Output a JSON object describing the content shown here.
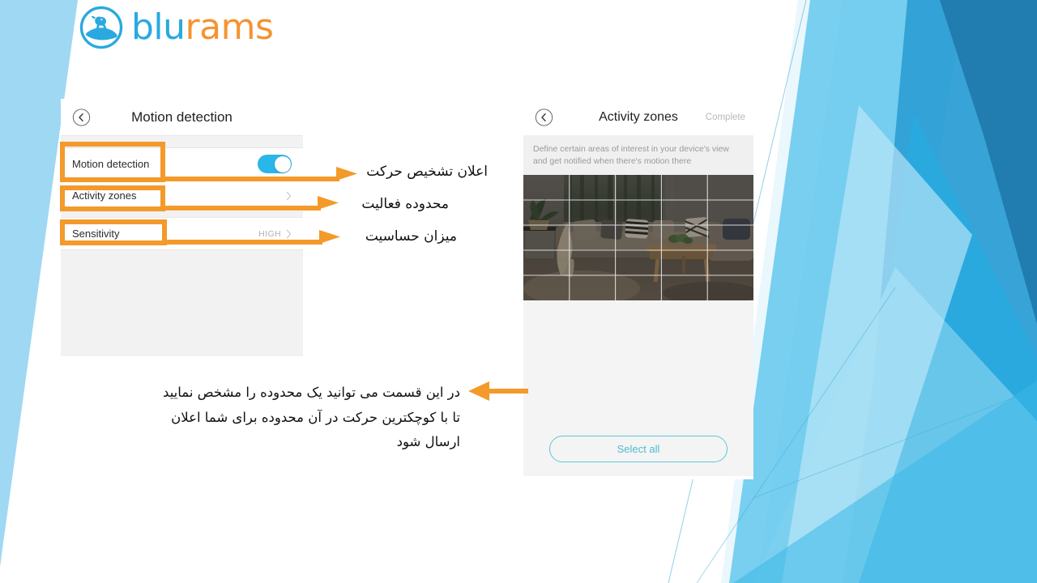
{
  "brand": {
    "name_part1": "blu",
    "name_part2": "rams",
    "logo_icon": "ram-circle-logo",
    "blue": "#29a9e0",
    "orange": "#f59331"
  },
  "left_panel": {
    "back_icon": "back-chevron-circle-icon",
    "title": "Motion detection",
    "rows": [
      {
        "label": "Motion detection",
        "control": "toggle",
        "toggle_on": true,
        "value": ""
      },
      {
        "label": "Activity zones",
        "control": "chevron",
        "value": ""
      },
      {
        "label": "Sensitivity",
        "control": "chevron",
        "value": "HIGH"
      }
    ]
  },
  "right_panel": {
    "back_icon": "back-chevron-circle-icon",
    "title": "Activity zones",
    "action_label": "Complete",
    "description": "Define certain areas of interest in your device's view and get notified when there's motion there",
    "camera_preview": {
      "alt": "living-room-camera-view",
      "grid_columns": 5,
      "grid_rows": 5
    },
    "select_all_label": "Select all"
  },
  "annotations": {
    "callout_1": "اعلان تشخیص حرکت",
    "callout_2": "محدوده فعالیت",
    "callout_3": "میزان حساسیت",
    "paragraph_lines": [
      "در این قسمت می توانید یک محدوده را مشخص نمایید",
      "تا با کوچکترین حرکت در آن محدوده برای شما اعلان",
      "ارسال شود"
    ],
    "highlight_color": "#F39A2B",
    "arrow_color": "#F39A2B"
  }
}
